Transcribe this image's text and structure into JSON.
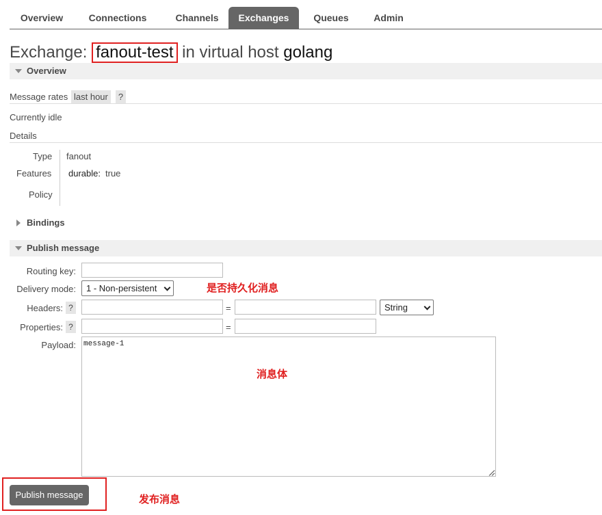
{
  "nav": {
    "tabs": [
      {
        "label": "Overview",
        "active": false
      },
      {
        "label": "Connections",
        "active": false
      },
      {
        "label": "Channels",
        "active": false
      },
      {
        "label": "Exchanges",
        "active": true
      },
      {
        "label": "Queues",
        "active": false
      },
      {
        "label": "Admin",
        "active": false
      }
    ]
  },
  "header": {
    "prefix": "Exchange:",
    "exchange_name": "fanout-test",
    "middle": "in virtual host",
    "vhost": "golang"
  },
  "overview": {
    "section_title": "Overview",
    "message_rates_label": "Message rates",
    "message_rates_period": "last hour",
    "help": "?",
    "status": "Currently idle",
    "details_title": "Details",
    "details": {
      "type_label": "Type",
      "type_value": "fanout",
      "features_label": "Features",
      "features_key": "durable:",
      "features_value": "true",
      "policy_label": "Policy"
    }
  },
  "bindings": {
    "section_title": "Bindings"
  },
  "publish": {
    "section_title": "Publish message",
    "routing_key_label": "Routing key:",
    "routing_key_value": "",
    "delivery_mode_label": "Delivery mode:",
    "delivery_mode_value": "1 - Non-persistent",
    "headers_label": "Headers:",
    "headers_type_value": "String",
    "properties_label": "Properties:",
    "help": "?",
    "equals": "=",
    "payload_label": "Payload:",
    "payload_value": "message-1",
    "submit_label": "Publish message"
  },
  "annotations": {
    "delivery_mode": "是否持久化消息",
    "payload": "消息体",
    "submit": "发布消息"
  },
  "colors": {
    "annotation_red": "#e02020",
    "active_tab": "#666666",
    "section_bg": "#f0f0f0"
  }
}
